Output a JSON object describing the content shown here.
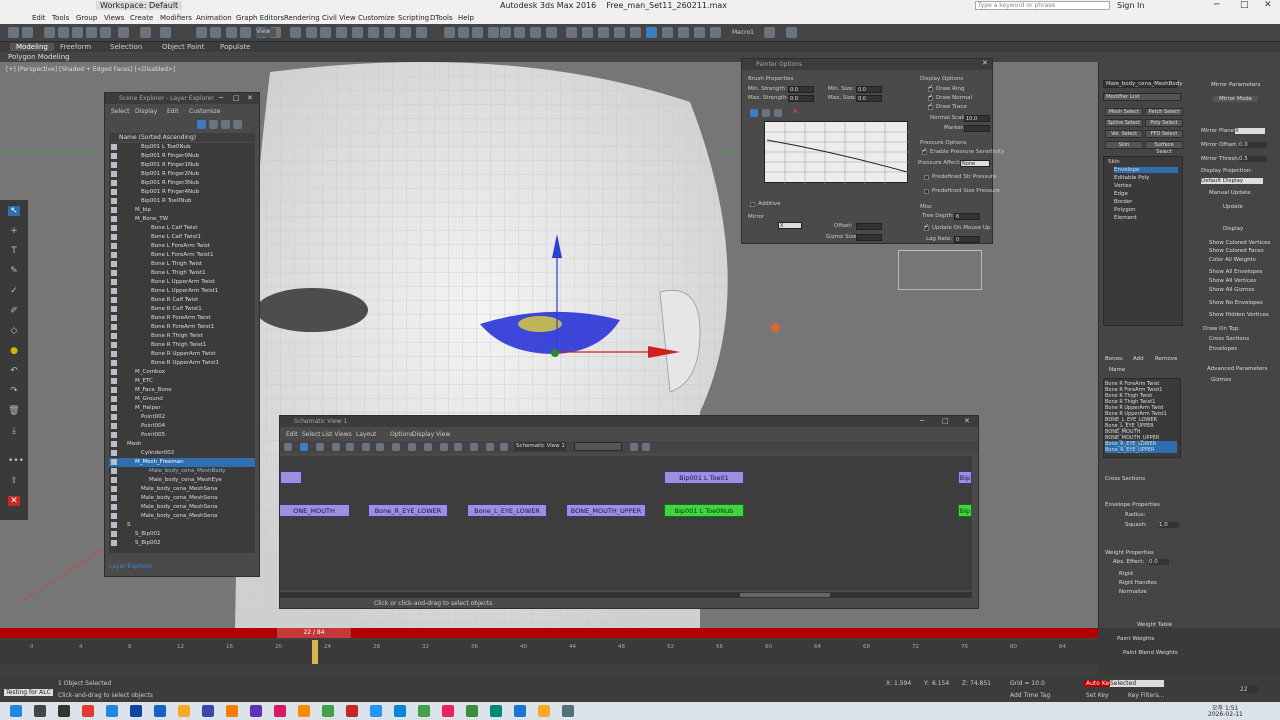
{
  "app": {
    "title": "Autodesk 3ds Max 2016",
    "file": "Free_man_Set11_260211.max",
    "workspace": "Workspace: Default",
    "search_placeholder": "Type a keyword or phrase",
    "sign_in": "Sign In"
  },
  "menu": [
    "Edit",
    "Tools",
    "Group",
    "Views",
    "Create",
    "Modifiers",
    "Animation",
    "Graph Editors",
    "Rendering",
    "Civil View",
    "Customize",
    "Scripting",
    "DTools",
    "Help"
  ],
  "toolbar": {
    "view_dropdown": "View",
    "macro_label": "Macro1"
  },
  "ribbon": {
    "tabs": [
      "Modeling",
      "Freeform",
      "Selection",
      "Object Paint",
      "Populate"
    ],
    "sub": "Polygon Modeling"
  },
  "viewport": {
    "label": "[+] [Perspective] [Shaded + Edged Faces] [<Disabled>]"
  },
  "scene_explorer": {
    "title": "Scene Explorer - Layer Explorer",
    "menu": [
      "Select",
      "Display",
      "Edit",
      "Customize"
    ],
    "column_header": "Name (Sorted Ascending)",
    "rows": [
      "Bip001 L Toe0Nub",
      "Bip001 R Finger0Nub",
      "Bip001 R Finger1Nub",
      "Bip001 R Finger2Nub",
      "Bip001 R Finger3Nub",
      "Bip001 R Finger4Nub",
      "Bip001 R Toe0Nub",
      "M_bip",
      "M_Bone_TW",
      "Bone L Calf Twist",
      "Bone L Calf Twist1",
      "Bone L ForeArm Twist",
      "Bone L ForeArm Twist1",
      "Bone L Thigh Twist",
      "Bone L Thigh Twist1",
      "Bone L UpperArm Twist",
      "Bone L UpperArm Twist1",
      "Bone R Calf Twist",
      "Bone R Calf Twist1",
      "Bone R ForeArm Twist",
      "Bone R ForeArm Twist1",
      "Bone R Thigh Twist",
      "Bone R Thigh Twist1",
      "Bone R UpperArm Twist",
      "Bone R UpperArm Twist1",
      "M_Combox",
      "M_ETC",
      "M_Face_Bone",
      "M_Ground",
      "M_Helper",
      "Point002",
      "Point004",
      "Point005",
      "Mesh",
      "Cylinder002",
      "M_Mesh_Freeman",
      "Male_body_cena_MeshBody",
      "Male_body_cena_MeshEye",
      "Male_body_cena_MeshSena",
      "Male_body_cena_MeshSena",
      "Male_body_cena_MeshSena",
      "Male_body_cena_MeshSena",
      "S",
      "S_Bip001",
      "S_Bip002"
    ],
    "footer": "Layer Explorer"
  },
  "painter": {
    "title": "Painter Options",
    "brush_properties": "Brush Properties",
    "min_strength_label": "Min. Strength:",
    "min_strength": "0.0",
    "max_strength_label": "Max. Strength:",
    "max_strength": "0.0",
    "min_size_label": "Min. Size:",
    "min_size": "0.0",
    "max_size_label": "Max. Size:",
    "max_size": "0.0",
    "display_options": "Display Options",
    "draw_ring": "Draw Ring",
    "draw_normal": "Draw Normal",
    "draw_trace": "Draw Trace",
    "normal_scale_label": "Normal Scale:",
    "normal_scale": "10.0",
    "marker_label": "Marker:",
    "pressure_options": "Pressure Options",
    "enable_pressure": "Enable Pressure Sensitivity",
    "pressure_affects_label": "Pressure Affects:",
    "pressure_affects": "None",
    "predefined_str": "Predefined Str Pressure",
    "predefined_size": "Predefined Size Pressure",
    "additive": "Additive",
    "mirror_label": "Mirror",
    "mirror_value": "X",
    "offset_label": "Offset:",
    "gizmo_size_label": "Gizmo Size:",
    "misc": "Misc",
    "tree_depth_label": "Tree Depth:",
    "tree_depth": "6",
    "update_on_mouse_up": "Update On Mouse Up",
    "lag_rate_label": "Lag Rate:",
    "lag_rate": "0"
  },
  "schematic": {
    "title": "Schematic View 1",
    "menu": [
      "Edit",
      "Select",
      "List Views",
      "Layout",
      "Options",
      "Display",
      "View"
    ],
    "view_name": "Schematic View 1",
    "nodes_row1": [
      "Bip001 L Toe01",
      "Bip"
    ],
    "nodes_row2": [
      "ONE_MOUTH",
      "Bone_R_EYE_LOWER",
      "Bone_L_EYE_LOWER",
      "BONE_MOUTH_UPPER",
      "Bip001 L Toe0Nub",
      "Bip"
    ],
    "status": "Click or click-and-drag to select objects"
  },
  "right_panel": {
    "object_name": "Male_body_cena_MeshBody",
    "modifier_list": "Modifier List",
    "buttons": [
      "Mesh Select",
      "Patch Select",
      "Spline Select",
      "Poly Select",
      "Vol. Select",
      "FFD Select",
      "Skin",
      "Surface Select"
    ],
    "stack": [
      "Skin",
      "Envelope",
      "Editable Poly",
      "Vertex",
      "Edge",
      "Border",
      "Polygon",
      "Element"
    ],
    "mirror_params": "Mirror Parameters",
    "mirror_mode": "Mirror Mode",
    "mirror_plane_label": "Mirror Plane:",
    "mirror_plane": "X",
    "mirror_offset_label": "Mirror Offset:",
    "mirror_offset": "0.0",
    "mirror_thresh_label": "Mirror Thresh.:",
    "mirror_thresh": "0.5",
    "display_projection": "Display Projection:",
    "default_display": "Default Display",
    "manual_update": "Manual Update",
    "update": "Update",
    "display": "Display",
    "display_checks": [
      "Show Colored Vertices",
      "Show Colored Faces",
      "Color All Weights",
      "Show All Envelopes",
      "Show All Vertices",
      "Show All Gizmos",
      "Show No Envelopes",
      "Show Hidden Vertices"
    ],
    "draw_on_top": "Draw On Top:",
    "cross_sections": "Cross Sections",
    "envelopes": "Envelopes",
    "advanced": "Advanced Parameters",
    "gizmos": "Gizmos",
    "bones_label": "Bones:",
    "add": "Add",
    "remove": "Remove",
    "name_col": "Name",
    "bones": [
      "Bone R ForeArm Twist",
      "Bone R ForeArm Twist1",
      "Bone R Thigh Twist",
      "Bone R Thigh Twist1",
      "Bone R UpperArm Twist",
      "Bone R UpperArm Twist1",
      "BONE_L_EYE_LOWER",
      "Bone_L_EYE_UPPER",
      "BONE_MOUTH",
      "BONE_MOUTH_UPPER",
      "Bone_R_EYE_LOWER",
      "Bone_R_EYE_UPPER"
    ],
    "cross_sections_head": "Cross Sections",
    "envelope_props": "Envelope Properties",
    "radius_label": "Radius:",
    "squash_label": "Squash:",
    "squash": "1.0",
    "weight_props": "Weight Properties",
    "abs_effect_label": "Abs. Effect:",
    "abs_effect": "0.0",
    "rigid": "Rigid",
    "rigid_handles": "Rigid Handles",
    "normalize": "Normalize",
    "weight_table": "Weight Table",
    "paint_weights": "Paint Weights",
    "paint_blend": "Paint Blend Weights"
  },
  "timeline": {
    "frame": "22 / 84",
    "ticks": [
      "0",
      "4",
      "8",
      "12",
      "16",
      "20",
      "24",
      "28",
      "32",
      "36",
      "40",
      "44",
      "48",
      "52",
      "56",
      "60",
      "64",
      "68",
      "72",
      "76",
      "80",
      "84"
    ]
  },
  "status": {
    "selected": "1 Object Selected",
    "hint": "Click-and-drag to select objects",
    "x_label": "X:",
    "x": "1.594",
    "y_label": "Y:",
    "y": "6.154",
    "z_label": "Z:",
    "z": "74.851",
    "grid": "Grid = 10.0",
    "add_time_tag": "Add Time Tag",
    "auto_key": "Auto Key",
    "set_key": "Set Key",
    "selected_dd": "Selected",
    "key_filters": "Key Filters...",
    "frame_field": "22",
    "maxscript": "Testing for ALC"
  },
  "clock": {
    "time": "오후 1:51",
    "date": "2026-02-11"
  },
  "colors": {
    "accent": "#2f6fb0",
    "node": "#9b8fe0",
    "node_sel": "#3fd63f",
    "timeline": "#b00000"
  }
}
